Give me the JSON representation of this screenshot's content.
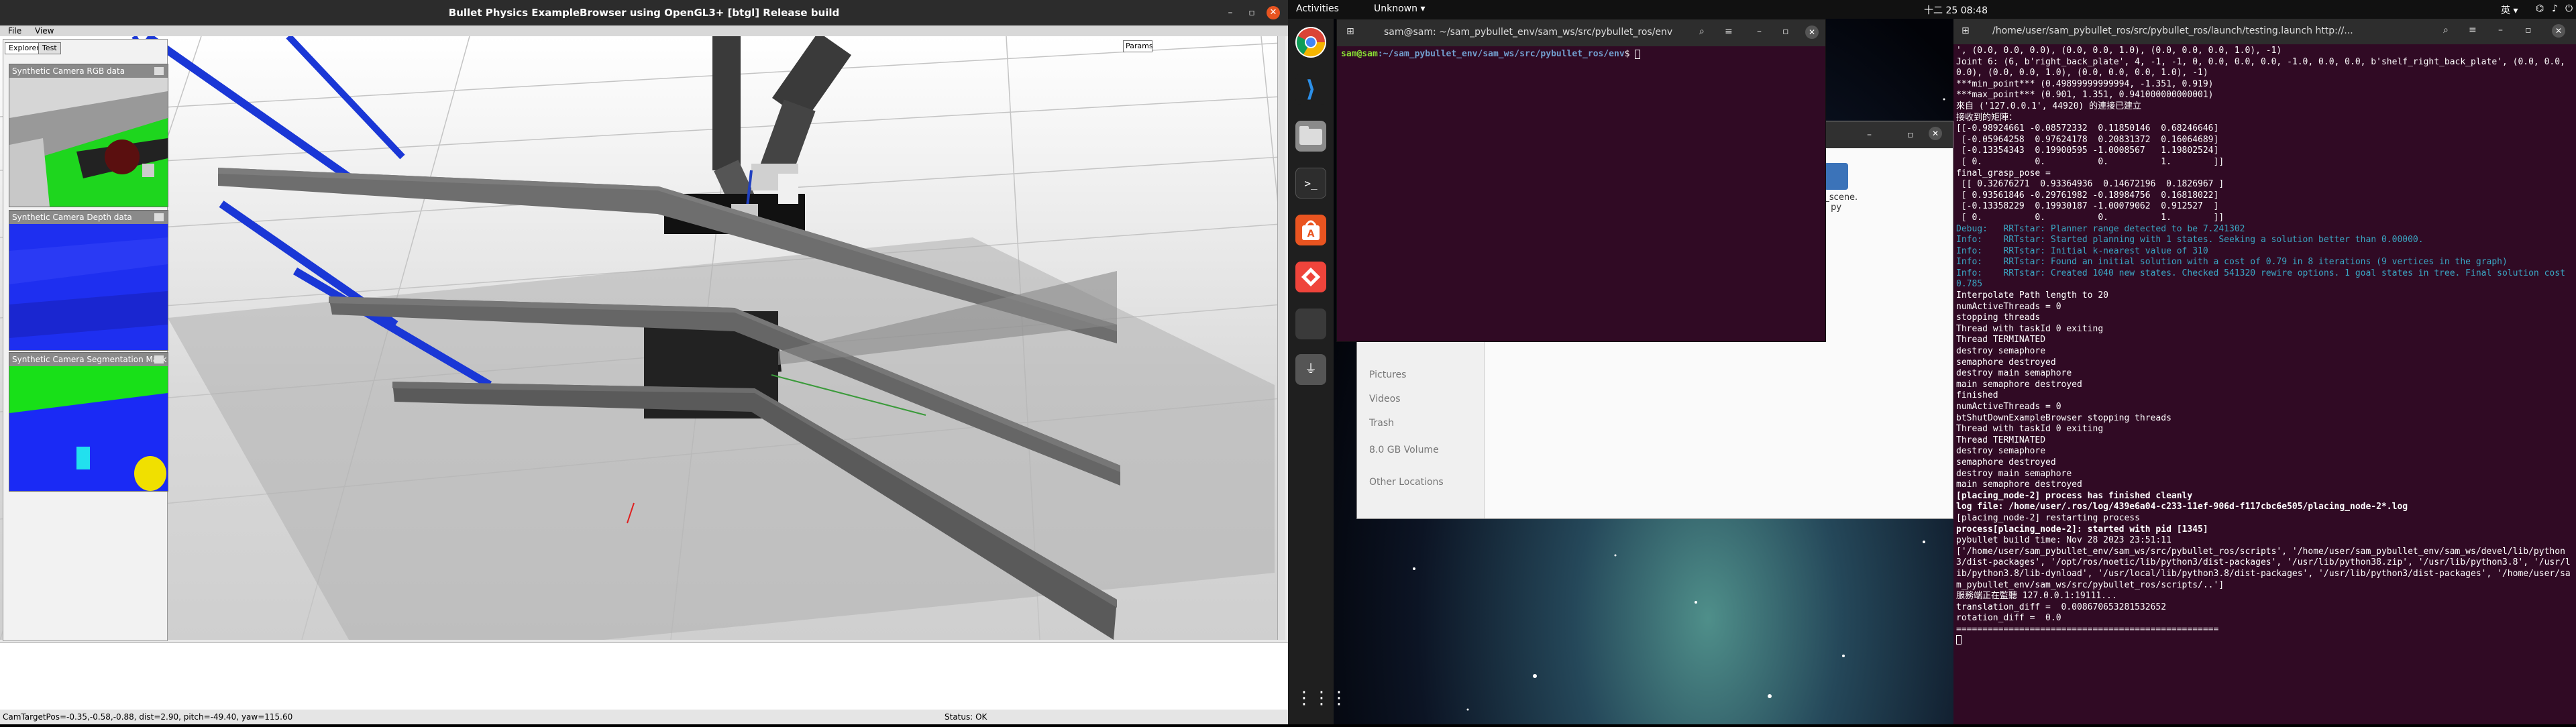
{
  "bullet": {
    "title": "Bullet Physics ExampleBrowser using OpenGL3+ [btgl] Release build",
    "menu": {
      "file": "File",
      "view": "View"
    },
    "explorer_tabs": [
      "Explorer",
      "Test"
    ],
    "camera_panels": [
      {
        "title": "Synthetic Camera RGB data"
      },
      {
        "title": "Synthetic Camera Depth data"
      },
      {
        "title": "Synthetic Camera Segmentation Mask"
      }
    ],
    "params_label": "Params",
    "status_left": "CamTargetPos=-0.35,-0.58,-0.88, dist=2.90, pitch=-49.40, yaw=115.60",
    "status_right": "Status: OK"
  },
  "topbar": {
    "activities": "Activities",
    "app_menu": "Unknown ▾",
    "clock": "十二 25  08:48",
    "indicators": "英 ▾"
  },
  "dock_icons": [
    "chrome-icon",
    "vscode-icon",
    "files-icon",
    "terminal-icon",
    "software-icon",
    "anydesk-icon",
    "blank-app-icon",
    "usb-icon",
    "apps-grid-icon"
  ],
  "files": {
    "sidebar": [
      "Pictures",
      "Videos",
      "Trash",
      "8.0 GB Volume",
      "Other Locations"
    ],
    "file_name": "cb_scene.\npy"
  },
  "term1": {
    "title": "sam@sam: ~/sam_pybullet_env/sam_ws/src/pybullet_ros/env",
    "prompt_user": "sam@sam",
    "prompt_path": ":~/sam_pybullet_env/sam_ws/src/pybullet_ros/env",
    "prompt_char": "$ "
  },
  "term2": {
    "title": "/home/user/sam_pybullet_ros/src/pybullet_ros/launch/testing.launch http://...",
    "lines": [
      {
        "t": "', (0.0, 0.0, 0.0), (0.0, 0.0, 1.0), (0.0, 0.0, 0.0, 1.0), -1)",
        "c": ""
      },
      {
        "t": "Joint 6: (6, b'right_back_plate', 4, -1, -1, 0, 0.0, 0.0, 0.0, -1.0, 0.0, 0.0, b'shelf_right_back_plate', (0.0, 0.0, 0.0), (0.0, 0.0, 1.0), (0.0, 0.0, 0.0, 1.0), -1)",
        "c": ""
      },
      {
        "t": "***min_point*** (0.49899999999994, -1.351, 0.919)",
        "c": ""
      },
      {
        "t": "***max_point*** (0.901, 1.351, 0.941000000000001)",
        "c": ""
      },
      {
        "t": "來自 ('127.0.0.1', 44920) 的連接已建立",
        "c": ""
      },
      {
        "t": "接收到的矩陣：",
        "c": ""
      },
      {
        "t": "[[-0.98924661 -0.08572332  0.11850146  0.68246646]",
        "c": ""
      },
      {
        "t": " [-0.05964258  0.97624178  0.20831372  0.16064689]",
        "c": ""
      },
      {
        "t": " [-0.13354343  0.19900595 -1.0008567   1.19802524]",
        "c": ""
      },
      {
        "t": " [ 0.          0.          0.          1.        ]]",
        "c": ""
      },
      {
        "t": "final_grasp_pose =",
        "c": ""
      },
      {
        "t": " [[ 0.32676271  0.93364936  0.14672196  0.1826967 ]",
        "c": ""
      },
      {
        "t": " [ 0.93561846 -0.29761982 -0.18984756  0.16818022]",
        "c": ""
      },
      {
        "t": " [-0.13358229  0.19930187 -1.00079062  0.912527  ]",
        "c": ""
      },
      {
        "t": " [ 0.          0.          0.          1.        ]]",
        "c": ""
      },
      {
        "t": "Debug:   RRTstar: Planner range detected to be 7.241302",
        "c": "info"
      },
      {
        "t": "Info:    RRTstar: Started planning with 1 states. Seeking a solution better than 0.00000.",
        "c": "info"
      },
      {
        "t": "Info:    RRTstar: Initial k-nearest value of 310",
        "c": "info"
      },
      {
        "t": "Info:    RRTstar: Found an initial solution with a cost of 0.79 in 8 iterations (9 vertices in the graph)",
        "c": "info"
      },
      {
        "t": "Info:    RRTstar: Created 1040 new states. Checked 541320 rewire options. 1 goal states in tree. Final solution cost 0.785",
        "c": "info"
      },
      {
        "t": "Interpolate Path length to 20",
        "c": ""
      },
      {
        "t": "numActiveThreads = 0",
        "c": ""
      },
      {
        "t": "stopping threads",
        "c": ""
      },
      {
        "t": "Thread with taskId 0 exiting",
        "c": ""
      },
      {
        "t": "Thread TERMINATED",
        "c": ""
      },
      {
        "t": "destroy semaphore",
        "c": ""
      },
      {
        "t": "semaphore destroyed",
        "c": ""
      },
      {
        "t": "destroy main semaphore",
        "c": ""
      },
      {
        "t": "main semaphore destroyed",
        "c": ""
      },
      {
        "t": "finished",
        "c": ""
      },
      {
        "t": "numActiveThreads = 0",
        "c": ""
      },
      {
        "t": "btShutDownExampleBrowser stopping threads",
        "c": ""
      },
      {
        "t": "Thread with taskId 0 exiting",
        "c": ""
      },
      {
        "t": "Thread TERMINATED",
        "c": ""
      },
      {
        "t": "destroy semaphore",
        "c": ""
      },
      {
        "t": "semaphore destroyed",
        "c": ""
      },
      {
        "t": "destroy main semaphore",
        "c": ""
      },
      {
        "t": "main semaphore destroyed",
        "c": ""
      },
      {
        "t": "[placing_node-2] process has finished cleanly",
        "c": "bold"
      },
      {
        "t": "log file: /home/user/.ros/log/439e6a04-c233-11ef-906d-f117cbc6e505/placing_node-2*.log",
        "c": "bold"
      },
      {
        "t": "[placing_node-2] restarting process",
        "c": ""
      },
      {
        "t": "process[placing_node-2]: started with pid [1345]",
        "c": "bold"
      },
      {
        "t": "pybullet build time: Nov 28 2023 23:51:11",
        "c": ""
      },
      {
        "t": "['/home/user/sam_pybullet_env/sam_ws/src/pybullet_ros/scripts', '/home/user/sam_pybullet_env/sam_ws/devel/lib/python3/dist-packages', '/opt/ros/noetic/lib/python3/dist-packages', '/usr/lib/python38.zip', '/usr/lib/python3.8', '/usr/lib/python3.8/lib-dynload', '/usr/local/lib/python3.8/dist-packages', '/usr/lib/python3/dist-packages', '/home/user/sam_pybullet_env/sam_ws/src/pybullet_ros/scripts/..']",
        "c": ""
      },
      {
        "t": "服務端正在監聽 127.0.0.1:19111...",
        "c": ""
      },
      {
        "t": "translation_diff =  0.008670653281532652",
        "c": ""
      },
      {
        "t": "rotation_diff =  0.0",
        "c": ""
      },
      {
        "t": "==================================================",
        "c": ""
      }
    ]
  },
  "colors": {
    "terminal_bg": "#300a24",
    "prompt_user": "#8ae234",
    "prompt_path": "#729fcf",
    "ubuntu_orange": "#e95420",
    "info_text": "#3aa7c4"
  }
}
